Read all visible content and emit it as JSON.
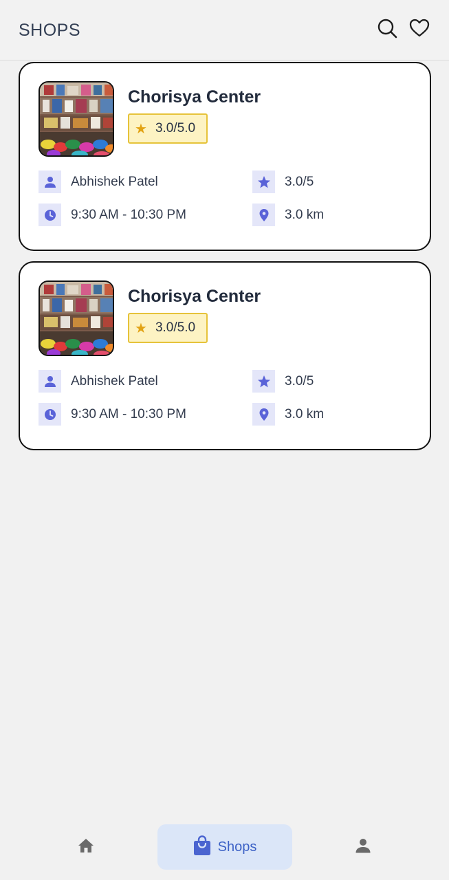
{
  "header": {
    "title": "SHOPS",
    "icons": [
      "search-icon",
      "heart-icon"
    ]
  },
  "shops": [
    {
      "name": "Chorisya Center",
      "rating_badge": "3.0/5.0",
      "owner": "Abhishek Patel",
      "rating": "3.0/5",
      "hours": "9:30 AM - 10:30 PM",
      "distance": "3.0 km"
    },
    {
      "name": "Chorisya Center",
      "rating_badge": "3.0/5.0",
      "owner": "Abhishek Patel",
      "rating": "3.0/5",
      "hours": "9:30 AM - 10:30 PM",
      "distance": "3.0 km"
    }
  ],
  "bottom_nav": {
    "items": [
      {
        "icon": "home-icon",
        "label": ""
      },
      {
        "icon": "shopping-bag-icon",
        "label": "Shops",
        "active": true
      },
      {
        "icon": "profile-icon",
        "label": ""
      }
    ]
  },
  "colors": {
    "accent": "#5a63d8",
    "active_tab_bg": "#dbe6f8",
    "rating_badge_bg": "#fdf3c3",
    "rating_badge_border": "#e6c33a",
    "star": "#e2a314"
  }
}
